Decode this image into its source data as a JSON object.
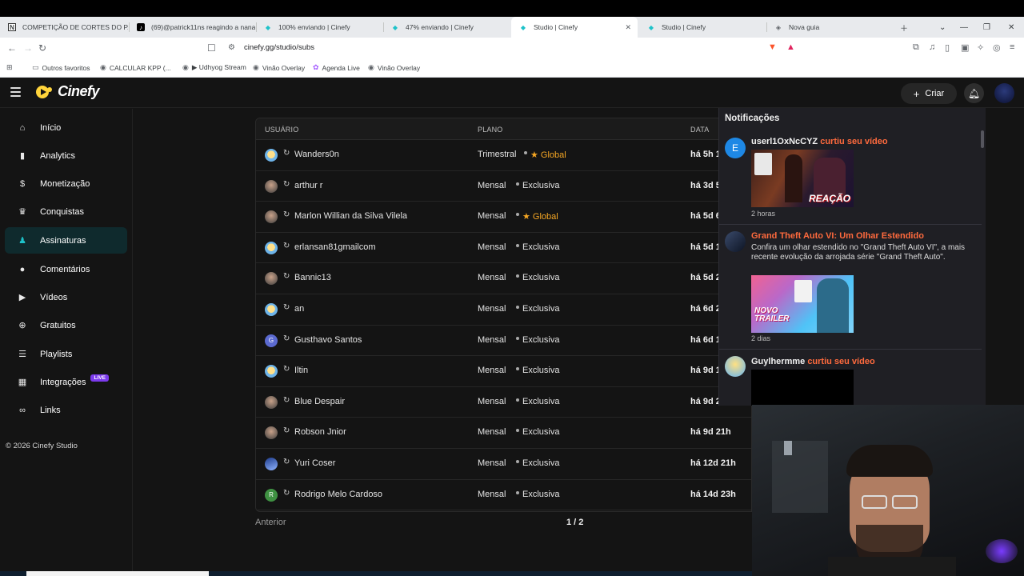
{
  "browser": {
    "tabs": [
      {
        "title": "COMPETIÇÃO DE CORTES DO PATR",
        "icon": "notion-icon",
        "active": false
      },
      {
        "title": "(69)@patrick11ns reagindo a nanas",
        "icon": "tiktok-icon",
        "active": false
      },
      {
        "title": "100% enviando | Cinefy",
        "icon": "cinefy-icon",
        "active": false
      },
      {
        "title": "47% enviando | Cinefy",
        "icon": "cinefy-icon",
        "active": false
      },
      {
        "title": "Studio | Cinefy",
        "icon": "cinefy-icon",
        "active": true
      },
      {
        "title": "Studio | Cinefy",
        "icon": "cinefy-icon",
        "active": false
      },
      {
        "title": "Nova guia",
        "icon": "brave-icon",
        "active": false
      }
    ],
    "url": "cinefy.gg/studio/subs",
    "bookmarks": [
      {
        "label": "Outros favoritos",
        "icon": "folder-icon"
      },
      {
        "label": "CALCULAR KPP (...",
        "icon": "sheet-icon"
      },
      {
        "label": "▶ Udhyog Stream",
        "icon": "globe-icon"
      },
      {
        "label": "Vinão Overlay",
        "icon": "globe-icon"
      },
      {
        "label": "Agenda Live",
        "icon": "figma-icon"
      },
      {
        "label": "Vinão Overlay",
        "icon": "globe-icon"
      }
    ]
  },
  "app": {
    "brand": "Cinefy",
    "create_label": "Criar",
    "accent": "#1ec2c9",
    "highlight": "#ff6a3d"
  },
  "sidebar": {
    "items": [
      {
        "label": "Início",
        "icon": "home-icon",
        "active": false
      },
      {
        "label": "Analytics",
        "icon": "bar-chart-icon",
        "active": false
      },
      {
        "label": "Monetização",
        "icon": "dollar-icon",
        "active": false
      },
      {
        "label": "Conquistas",
        "icon": "trophy-icon",
        "active": false
      },
      {
        "label": "Assinaturas",
        "icon": "users-icon",
        "active": true
      },
      {
        "label": "Comentários",
        "icon": "comment-icon",
        "active": false
      },
      {
        "label": "Vídeos",
        "icon": "video-icon",
        "active": false
      },
      {
        "label": "Gratuitos",
        "icon": "plus-circle-icon",
        "active": false
      },
      {
        "label": "Playlists",
        "icon": "playlist-icon",
        "active": false
      },
      {
        "label": "Integrações",
        "icon": "grid-icon",
        "active": false,
        "badge": "LIVE"
      },
      {
        "label": "Links",
        "icon": "link-icon",
        "active": false
      }
    ],
    "copyright": "© 2026 Cinefy Studio"
  },
  "table": {
    "headers": {
      "user": "USUÁRIO",
      "plan": "PLANO",
      "date": "DATA"
    },
    "rows": [
      {
        "user": "Wanders0n",
        "plan": "Trimestral",
        "tier": "Global",
        "date": "há 5h 1",
        "avatar": "cartoon"
      },
      {
        "user": "arthur r",
        "plan": "Mensal",
        "tier": "Exclusiva",
        "date": "há 3d 5",
        "avatar": "photo"
      },
      {
        "user": "Marlon Willian da Silva Vilela",
        "plan": "Mensal",
        "tier": "Global",
        "date": "há 5d 6",
        "avatar": "photo"
      },
      {
        "user": "erlansan81gmailcom",
        "plan": "Mensal",
        "tier": "Exclusiva",
        "date": "há 5d 1",
        "avatar": "cartoon"
      },
      {
        "user": "Bannic13",
        "plan": "Mensal",
        "tier": "Exclusiva",
        "date": "há 5d 2",
        "avatar": "photo"
      },
      {
        "user": "an",
        "plan": "Mensal",
        "tier": "Exclusiva",
        "date": "há 6d 2",
        "avatar": "cartoon"
      },
      {
        "user": "Gusthavo Santos",
        "plan": "Mensal",
        "tier": "Exclusiva",
        "date": "há 6d 1",
        "avatar": "letter",
        "letter": "G",
        "color": "#5b6ad0"
      },
      {
        "user": "Iltin",
        "plan": "Mensal",
        "tier": "Exclusiva",
        "date": "há 9d 1",
        "avatar": "cartoon"
      },
      {
        "user": "Blue Despair",
        "plan": "Mensal",
        "tier": "Exclusiva",
        "date": "há 9d 2",
        "avatar": "photo"
      },
      {
        "user": "Robson Jnior",
        "plan": "Mensal",
        "tier": "Exclusiva",
        "date": "há 9d 21h",
        "avatar": "photo"
      },
      {
        "user": "Yuri Coser",
        "plan": "Mensal",
        "tier": "Exclusiva",
        "date": "há 12d 21h",
        "avatar": "blue"
      },
      {
        "user": "Rodrigo Melo Cardoso",
        "plan": "Mensal",
        "tier": "Exclusiva",
        "date": "há 14d 23h",
        "avatar": "letter",
        "letter": "R",
        "color": "#3f9142"
      }
    ],
    "prev_label": "Anterior",
    "pagination": "1 / 2"
  },
  "notifications": {
    "title": "Notificações",
    "items": [
      {
        "name": "userl1OxNcCYZ",
        "action": "curtiu seu vídeo",
        "avatar_letter": "E",
        "avatar_color": "#1e88e5",
        "thumb_caption": "REAÇÃO",
        "time": "2 horas"
      },
      {
        "title": "Grand Theft Auto VI: Um Olhar Estendido",
        "desc": "Confira um olhar estendido no \"Grand Theft Auto VI\", a mais recente evolução da arrojada série \"Grand Theft Auto\".",
        "thumb_caption": "NOVO TRAILER",
        "time": "2 dias"
      },
      {
        "name": "Guylhermme",
        "action": "curtiu seu vídeo"
      }
    ]
  }
}
